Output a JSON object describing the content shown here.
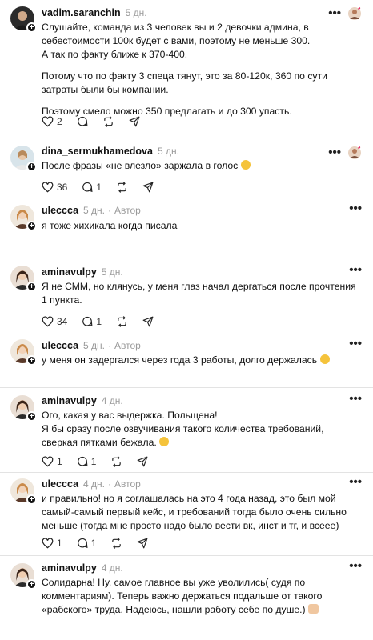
{
  "posts": [
    {
      "username": "vadim.saranchin",
      "time": "5 дн.",
      "paragraphs": [
        "Слушайте, команда из 3 человек вы и 2 девочки админа, в себестоимости 100к будет с вами, поэтому не меньше 300.",
        "А так по факту ближе к 370-400.",
        "Потому что по факту 3 спеца тянут, это за 80-120к, 360 по сути затраты были бы компании.",
        "Поэтому смело можно 350 предлагать и до 300 упасть."
      ],
      "likes": "2",
      "replies": "",
      "reposts": ""
    },
    {
      "username": "dina_sermukhamedova",
      "time": "5 дн.",
      "text": "После фразы «не влезло» заржала в голос",
      "likes": "36",
      "replies": "1",
      "reposts": ""
    },
    {
      "username": "ulecсса",
      "time": "5 дн.",
      "author": "Автор",
      "text": "я тоже хихикала когда писала"
    },
    {
      "username": "aminavulpy",
      "time": "5 дн.",
      "text": "Я не СММ, но клянусь, у меня глаз начал дергаться после прочтения 1 пункта.",
      "likes": "34",
      "replies": "1",
      "reposts": ""
    },
    {
      "username": "ulecсса",
      "time": "5 дн.",
      "author": "Автор",
      "text": "у меня он задергался через года 3 работы, долго держалась"
    },
    {
      "username": "aminavulpy",
      "time": "4 дн.",
      "paragraphs_tight": [
        "Ого, какая у вас выдержка. Польщена!",
        "Я бы сразу после озвучивания такого количества требований, сверкая пятками бежала."
      ],
      "likes": "1",
      "replies": "1",
      "reposts": ""
    },
    {
      "username": "ulecсса",
      "time": "4 дн.",
      "author": "Автор",
      "text": "и правильно! но я соглашалась на это 4 года назад, это был мой самый-самый первый кейс, и требований тогда было очень сильно меньше (тогда мне просто надо было вести вк, инст и тг, и всеее)",
      "likes": "1",
      "replies": "1",
      "reposts": ""
    },
    {
      "username": "aminavulpy",
      "time": "4 дн.",
      "text": "Солидарна! Ну, самое главное вы уже уволились( судя по комментариям). Теперь важно держаться подальше от такого «рабского» труда. Надеюсь, нашли работу себе по душе.)"
    }
  ],
  "dot_separator": "·",
  "colors": {
    "accent_avatar": "#c9a27a",
    "muted": "#9a9a9a"
  }
}
